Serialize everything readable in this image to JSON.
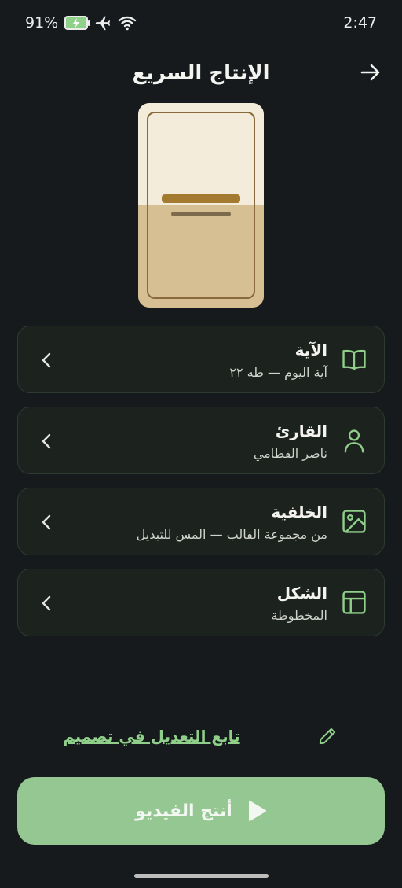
{
  "status": {
    "battery": "91%",
    "time": "2:47"
  },
  "header": {
    "title": "الإنتاج السريع"
  },
  "cards": [
    {
      "title": "الآية",
      "subtitle": "آية اليوم — طه ٢٢",
      "icon": "book-icon"
    },
    {
      "title": "القارئ",
      "subtitle": "ناصر القطامي",
      "icon": "person-icon"
    },
    {
      "title": "الخلفية",
      "subtitle": "من مجموعة القالب — المس للتبديل",
      "icon": "image-icon"
    },
    {
      "title": "الشكل",
      "subtitle": "المخطوطة",
      "icon": "layout-icon"
    }
  ],
  "edit": {
    "link_label": "تابع التعديل في تصميم",
    "icon": "pencil-icon"
  },
  "produce": {
    "label": "أنتج الفيديو",
    "icon": "play-icon"
  },
  "colors": {
    "background": "#161a1c",
    "card": "#1c221d",
    "accent_green": "#94c792",
    "icon_green": "#8fcf8a",
    "preview_top": "#f4ecdb",
    "preview_bottom": "#d6c093"
  }
}
